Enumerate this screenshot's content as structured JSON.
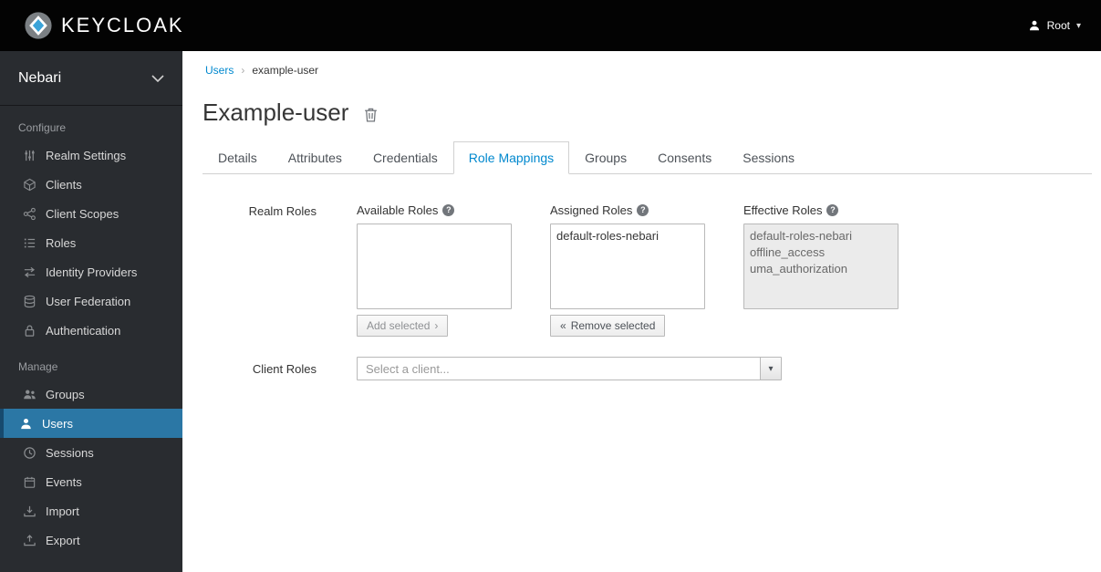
{
  "header": {
    "brand": "KEYCLOAK",
    "user_label": "Root"
  },
  "icons": {
    "help_glyph": "?",
    "caret_glyph": "▾"
  },
  "sidebar": {
    "realm": "Nebari",
    "sections": [
      {
        "label": "Configure",
        "items": [
          {
            "label": "Realm Settings",
            "icon": "sliders-icon"
          },
          {
            "label": "Clients",
            "icon": "cube-icon"
          },
          {
            "label": "Client Scopes",
            "icon": "share-icon"
          },
          {
            "label": "Roles",
            "icon": "list-icon"
          },
          {
            "label": "Identity Providers",
            "icon": "exchange-icon"
          },
          {
            "label": "User Federation",
            "icon": "database-icon"
          },
          {
            "label": "Authentication",
            "icon": "lock-icon"
          }
        ]
      },
      {
        "label": "Manage",
        "items": [
          {
            "label": "Groups",
            "icon": "users-group-icon"
          },
          {
            "label": "Users",
            "icon": "user-icon",
            "active": true
          },
          {
            "label": "Sessions",
            "icon": "clock-icon"
          },
          {
            "label": "Events",
            "icon": "calendar-icon"
          },
          {
            "label": "Import",
            "icon": "import-icon"
          },
          {
            "label": "Export",
            "icon": "export-icon"
          }
        ]
      }
    ]
  },
  "breadcrumb": {
    "items": [
      {
        "label": "Users"
      },
      {
        "label": "example-user"
      }
    ],
    "separator": "›"
  },
  "page": {
    "title": "Example-user"
  },
  "tabs": {
    "active": "Role Mappings",
    "items": [
      {
        "label": "Details"
      },
      {
        "label": "Attributes"
      },
      {
        "label": "Credentials"
      },
      {
        "label": "Role Mappings"
      },
      {
        "label": "Groups"
      },
      {
        "label": "Consents"
      },
      {
        "label": "Sessions"
      }
    ]
  },
  "form": {
    "realm_roles": {
      "label": "Realm Roles",
      "columns": {
        "available": {
          "header": "Available Roles",
          "items": [],
          "button_label": "Add selected",
          "button_icon": "›"
        },
        "assigned": {
          "header": "Assigned Roles",
          "items": [
            "default-roles-nebari"
          ],
          "button_label": "Remove selected",
          "button_icon": "«"
        },
        "effective": {
          "header": "Effective Roles",
          "items": [
            "default-roles-nebari",
            "offline_access",
            "uma_authorization"
          ],
          "disabled": true
        }
      }
    },
    "client_roles": {
      "label": "Client Roles",
      "placeholder": "Select a client..."
    }
  },
  "colors": {
    "header_bg": "#030303",
    "sidebar_bg": "#292c30",
    "active_item_bg": "#2b77a5",
    "link_blue": "#0088ce",
    "tab_active": "#0088ce"
  }
}
